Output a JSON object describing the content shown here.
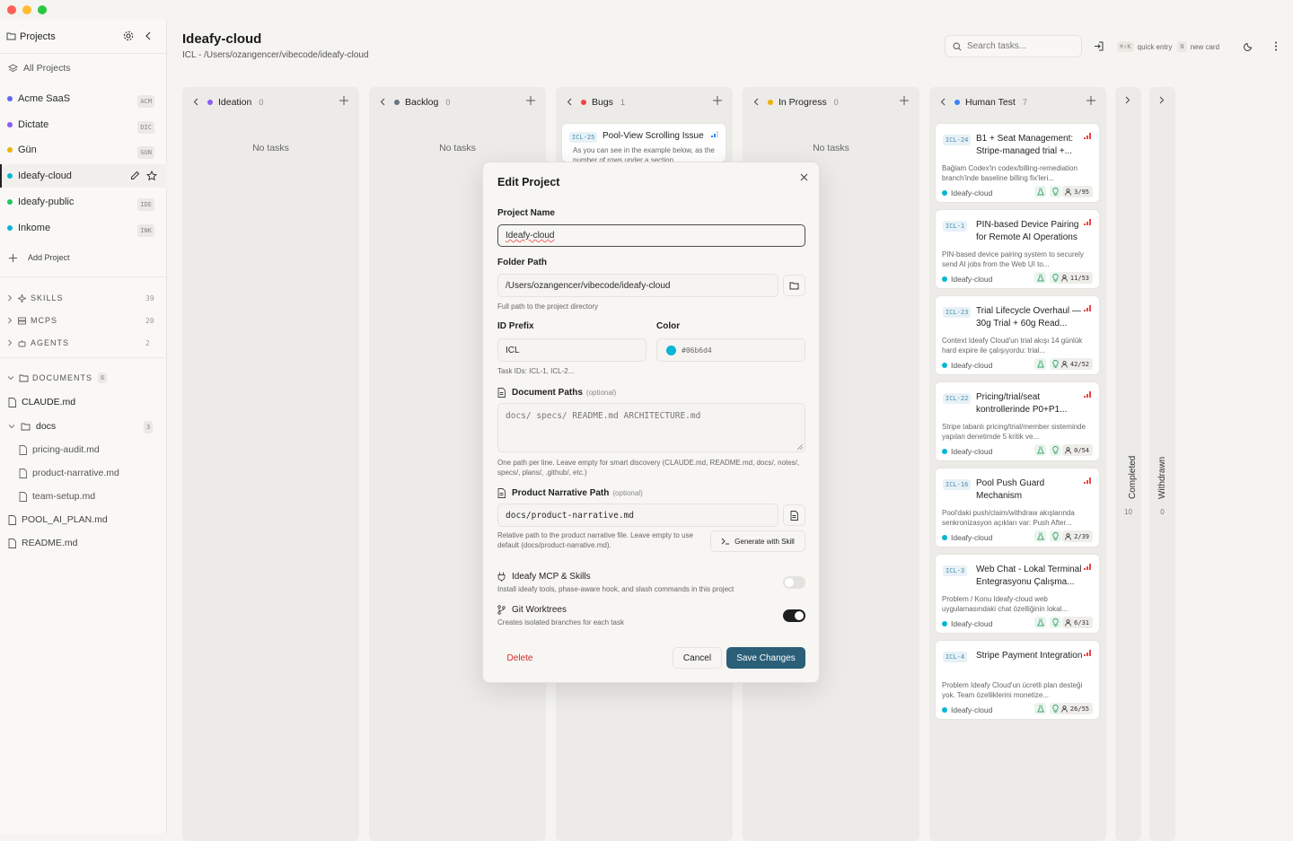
{
  "sidebar": {
    "title": "Projects",
    "all_projects": "All Projects",
    "projects": [
      {
        "name": "Acme SaaS",
        "code": "ACM",
        "color": "#6366f1"
      },
      {
        "name": "Dictate",
        "code": "DIC",
        "color": "#8b5cf6"
      },
      {
        "name": "Gün",
        "code": "GUN",
        "color": "#eab308"
      },
      {
        "name": "Ideafy-cloud",
        "code": "",
        "color": "#06b6d4"
      },
      {
        "name": "Ideafy-public",
        "code": "IDE",
        "color": "#22c55e"
      },
      {
        "name": "Inkome",
        "code": "INK",
        "color": "#06b6d4"
      }
    ],
    "add_project": "Add Project",
    "sections": [
      {
        "label": "SKILLS",
        "count": "39"
      },
      {
        "label": "MCPS",
        "count": "20"
      },
      {
        "label": "AGENTS",
        "count": "2"
      }
    ],
    "documents": {
      "label": "DOCUMENTS",
      "count": "6"
    },
    "docs": {
      "claude": "CLAUDE.md",
      "folder": "docs",
      "folder_count": "3",
      "children": [
        "pricing-audit.md",
        "product-narrative.md",
        "team-setup.md"
      ],
      "pool": "POOL_AI_PLAN.md",
      "readme": "README.md"
    }
  },
  "header": {
    "title": "Ideafy-cloud",
    "subtitle": "ICL - /Users/ozangencer/vibecode/ideafy-cloud",
    "search_placeholder": "Search tasks...",
    "quick_kbd": "⌘⇧K",
    "quick_label": "quick entry",
    "new_kbd": "N",
    "new_label": "new card"
  },
  "columns": [
    {
      "name": "Ideation",
      "count": "0",
      "color": "#8b5cf6",
      "empty": "No tasks"
    },
    {
      "name": "Backlog",
      "count": "0",
      "color": "#6b7280",
      "empty": "No tasks"
    },
    {
      "name": "Bugs",
      "count": "1",
      "color": "#ef4444"
    },
    {
      "name": "In Progress",
      "count": "0",
      "color": "#eab308",
      "empty": "No tasks"
    },
    {
      "name": "Human Test",
      "count": "7",
      "color": "#3b82f6"
    }
  ],
  "bug_card": {
    "id": "ICL-25",
    "title": "Pool-View Scrolling Issue",
    "desc": "As you can see in the example below, as the number of rows under a section"
  },
  "cards": [
    {
      "id": "ICL-24",
      "title": "B1 + Seat Management: Stripe-managed trial +...",
      "desc": "Bağlam Codex'in codex/billing-remediation branch'inde baseline billing fix'leri...",
      "project": "Ideafy-cloud",
      "progress": "3/95"
    },
    {
      "id": "ICL-1",
      "title": "PIN-based Device Pairing for Remote AI Operations",
      "desc": "PIN-based device pairing system to securely send AI jobs from the Web UI to...",
      "project": "Ideafy-cloud",
      "progress": "11/53"
    },
    {
      "id": "ICL-23",
      "title": "Trial Lifecycle Overhaul — 30g Trial + 60g Read...",
      "desc": "Context Ideafy Cloud'un trial akışı 14 günlük hard expire ile çalışıyordu: trial...",
      "project": "Ideafy-cloud",
      "progress": "42/52"
    },
    {
      "id": "ICL-22",
      "title": "Pricing/trial/seat kontrollerinde P0+P1...",
      "desc": "Stripe tabanlı pricing/trial/member sisteminde yapılan denetimde 5 kritik ve...",
      "project": "Ideafy-cloud",
      "progress": "0/54"
    },
    {
      "id": "ICL-16",
      "title": "Pool Push Guard Mechanism",
      "desc": "Pool'daki push/claim/withdraw akışlarında senkronizasyon açıkları var: Push After...",
      "project": "Ideafy-cloud",
      "progress": "2/39"
    },
    {
      "id": "ICL-3",
      "title": "Web Chat - Lokal Terminal Entegrasyonu Çalışma...",
      "desc": "Problem / Konu Ideafy-cloud web uygulamasındaki chat özelliğinin lokal...",
      "project": "Ideafy-cloud",
      "progress": "6/31"
    },
    {
      "id": "ICL-4",
      "title": "Stripe Payment Integration",
      "desc": "Problem Ideafy Cloud'un ücretli plan desteği yok. Team özelliklerini monetize...",
      "project": "Ideafy-cloud",
      "progress": "26/55"
    }
  ],
  "collapsed": [
    {
      "name": "Completed",
      "count": "10"
    },
    {
      "name": "Withdrawn",
      "count": "0"
    }
  ],
  "modal": {
    "title": "Edit Project",
    "name_label": "Project Name",
    "name_value": "Ideafy-cloud",
    "folder_label": "Folder Path",
    "folder_value": "/Users/ozangencer/vibecode/ideafy-cloud",
    "folder_help": "Full path to the project directory",
    "prefix_label": "ID Prefix",
    "prefix_value": "ICL",
    "prefix_help": "Task IDs: ICL-1, ICL-2...",
    "color_label": "Color",
    "color_value": "#06b6d4",
    "docpaths_label": "Document Paths",
    "optional": "(optional)",
    "docpaths_placeholder": "docs/ specs/ README.md ARCHITECTURE.md",
    "docpaths_help": "One path per line. Leave empty for smart discovery (CLAUDE.md, README.md, docs/, notes/, specs/, plans/, .github/, etc.)",
    "narrative_label": "Product Narrative Path",
    "narrative_value": "docs/product-narrative.md",
    "narrative_help": "Relative path to the product narrative file. Leave empty to use default (docs/product-narrative.md).",
    "generate_label": "Generate with Skill",
    "mcp_label": "Ideafy MCP & Skills",
    "mcp_help": "Install ideafy tools, phase-aware hook, and slash commands in this project",
    "mcp_on": false,
    "git_label": "Git Worktrees",
    "git_help": "Creates isolated branches for each task",
    "git_on": true,
    "delete_label": "Delete",
    "cancel_label": "Cancel",
    "save_label": "Save Changes"
  }
}
